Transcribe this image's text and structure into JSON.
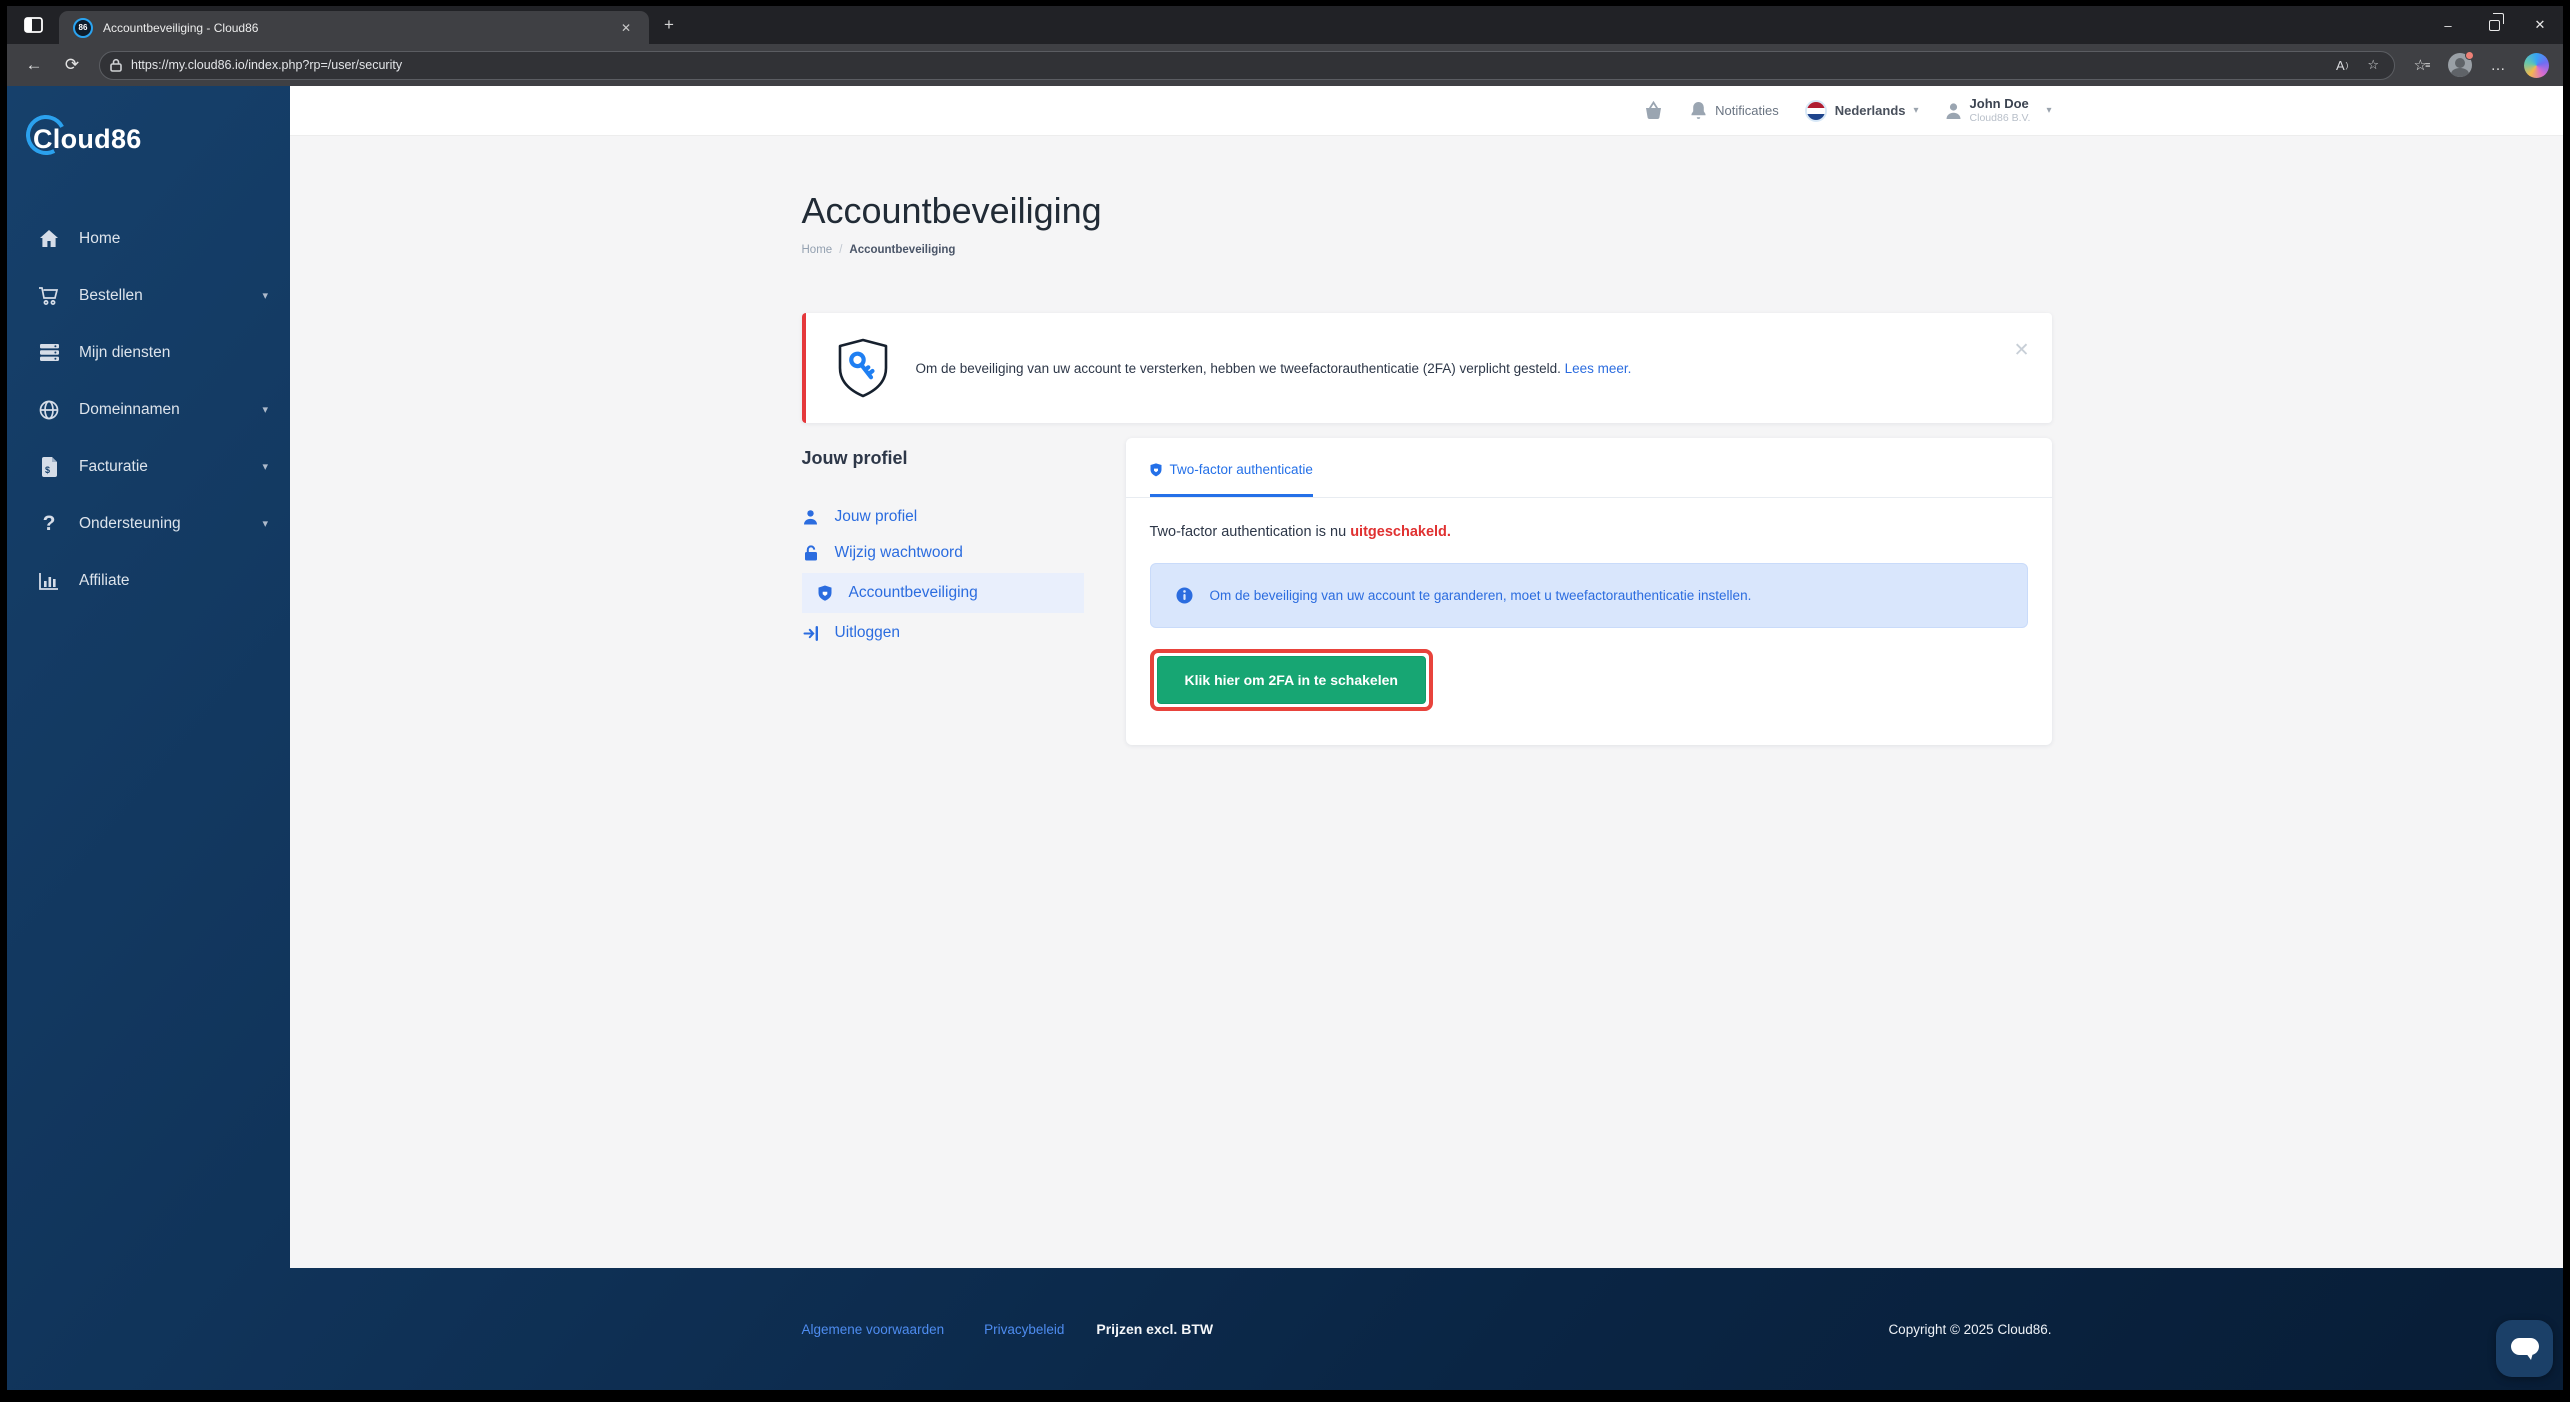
{
  "browser": {
    "tab_title": "Accountbeveiliging - Cloud86",
    "favicon_text": "86",
    "url": "https://my.cloud86.io/index.php?rp=/user/security",
    "glyphs": {
      "new_tab": "+",
      "tab_close": "✕",
      "minimize": "–",
      "close": "✕",
      "back": "←",
      "reload": "⟳",
      "read_aloud": "A",
      "read_aloud_mark": ")",
      "star": "☆",
      "fav_list_star": "☆",
      "fav_list_lines": "≡",
      "more": "…"
    }
  },
  "header": {
    "notifications_label": "Notificaties",
    "language": "Nederlands",
    "user_name": "John Doe",
    "user_company": "Cloud86 B.V.",
    "caret": "▾"
  },
  "sidebar": {
    "logo": "Cloud86",
    "caret": "▾",
    "items": [
      {
        "label": "Home"
      },
      {
        "label": "Bestellen"
      },
      {
        "label": "Mijn diensten"
      },
      {
        "label": "Domeinnamen"
      },
      {
        "label": "Facturatie"
      },
      {
        "label": "Ondersteuning"
      },
      {
        "label": "Affiliate"
      }
    ]
  },
  "main": {
    "page_title": "Accountbeveiliging",
    "breadcrumb": {
      "home": "Home",
      "separator": "/",
      "current": "Accountbeveiliging"
    },
    "alert": {
      "text": "Om de beveiliging van uw account te versterken, hebben we tweefactorauthenticatie (2FA) verplicht gesteld.",
      "link": "Lees meer.",
      "close": "✕"
    },
    "profile_nav": {
      "heading": "Jouw profiel",
      "items": [
        {
          "label": "Jouw profiel"
        },
        {
          "label": "Wijzig wachtwoord"
        },
        {
          "label": "Accountbeveiliging"
        },
        {
          "label": "Uitloggen"
        }
      ]
    },
    "card": {
      "tab_label": "Two-factor authenticatie",
      "status_prefix": "Two-factor authentication is nu ",
      "status_value": "uitgeschakeld.",
      "info_text": "Om de beveiliging van uw account te garanderen, moet u tweefactorauthenticatie instellen.",
      "button_label": "Klik hier om 2FA in te schakelen"
    }
  },
  "footer": {
    "terms": "Algemene voorwaarden",
    "privacy": "Privacybeleid",
    "note": "Prijzen excl. BTW",
    "copyright": "Copyright © 2025 Cloud86."
  },
  "colors": {
    "accent_blue": "#2b6cdf",
    "tab_blue": "#2470e8",
    "success_green": "#17a673",
    "alert_red": "#e5383b",
    "status_red": "#e03131",
    "annotation_red": "#e8433c",
    "sidebar_navy": "#123760",
    "info_bg": "#d9e6fc"
  }
}
